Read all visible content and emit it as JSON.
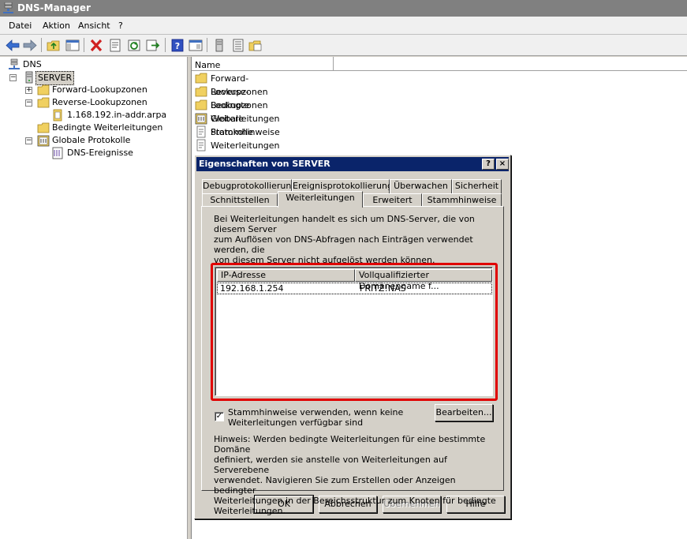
{
  "window": {
    "title": "DNS-Manager"
  },
  "menu": [
    "Datei",
    "Aktion",
    "Ansicht",
    "?"
  ],
  "toolbar_icons": [
    "back-icon",
    "forward-icon",
    "up-folder-icon",
    "show-hide-tree-icon",
    "delete-icon",
    "properties-icon",
    "refresh-icon",
    "export-icon",
    "help-icon",
    "mmc-icon",
    "server-icon",
    "list-icon",
    "folder-icon"
  ],
  "tree": {
    "root": "DNS",
    "server": "SERVER",
    "forward": "Forward-Lookupzonen",
    "reverse": "Reverse-Lookupzonen",
    "reverse_zone": "1.168.192.in-addr.arpa",
    "conditional": "Bedingte Weiterleitungen",
    "logs": "Globale Protokolle",
    "dns_events": "DNS-Ereignisse"
  },
  "list": {
    "header_name": "Name",
    "items": [
      "Forward-Lookupzonen",
      "Reverse-Lookupzonen",
      "Bedingte Weiterleitungen",
      "Globale Protokolle",
      "Stammhinweise",
      "Weiterleitungen"
    ]
  },
  "dialog": {
    "title": "Eigenschaften von SERVER",
    "help_btn": "?",
    "close_btn": "×",
    "tabs_row1": [
      "Debugprotokollierung",
      "Ereignisprotokollierung",
      "Überwachen",
      "Sicherheit"
    ],
    "tabs_row2": [
      "Schnittstellen",
      "Weiterleitungen",
      "Erweitert",
      "Stammhinweise"
    ],
    "description_lines": [
      "Bei Weiterleitungen handelt es sich um DNS-Server, die von diesem Server",
      "zum Auflösen von DNS-Abfragen nach Einträgen verwendet werden, die",
      "von diesem Server nicht aufgelöst werden können."
    ],
    "columns": [
      "IP-Adresse",
      "Vollqualifizierter Domänenname f..."
    ],
    "forwarders": [
      {
        "ip": "192.168.1.254",
        "fqdn": "FRITZ!NAS"
      }
    ],
    "use_root_hints_line1": "Stammhinweise verwenden, wenn keine",
    "use_root_hints_line2": "Weiterleitungen verfügbar sind",
    "use_root_hints_checked": true,
    "checkmark": "✓",
    "edit_btn": "Bearbeiten...",
    "hint_lines": [
      "Hinweis: Werden bedingte Weiterleitungen für eine bestimmte Domäne",
      "definiert, werden sie anstelle von Weiterleitungen auf Serverebene",
      "verwendet. Navigieren Sie zum Erstellen oder Anzeigen bedingter",
      "Weiterleitungen in der Bereichsstruktur zum Knoten für bedingte",
      "Weiterleitungen."
    ],
    "ok_btn": "OK",
    "cancel_btn": "Abbrechen",
    "apply_btn": "Übernehmen",
    "help_button": "Hilfe"
  },
  "colors": {
    "title_active": "#0a246a",
    "title_inactive": "#808080",
    "highlight": "#e00000"
  }
}
